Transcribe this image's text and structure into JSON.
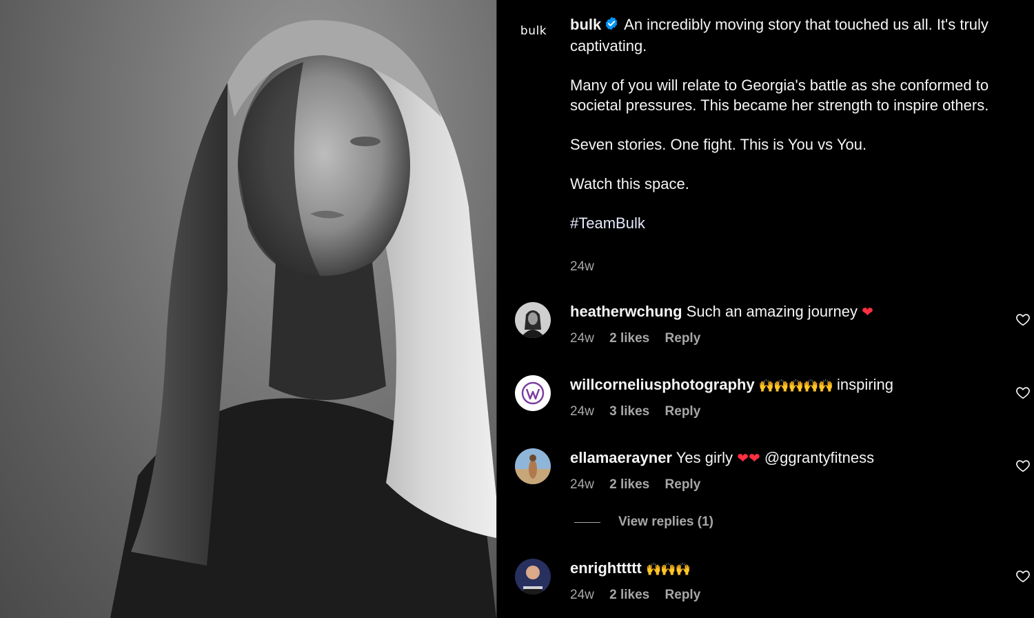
{
  "post": {
    "author": "bulk",
    "logo_text": "bulk",
    "caption_lines": [
      "An incredibly moving story that touched us all. It's truly captivating.",
      "Many of you will relate to Georgia's battle as she conformed to societal pressures. This became her strength to inspire others.",
      "Seven stories. One fight. This is You vs You.",
      "Watch this space.",
      "#TeamBulk"
    ],
    "time": "24w"
  },
  "comments": [
    {
      "user": "heatherwchung",
      "text": "Such an amazing journey",
      "emoji": "❤",
      "time": "24w",
      "likes": "2 likes",
      "reply": "Reply"
    },
    {
      "user": "willcorneliusphotography",
      "text": "inspiring",
      "emoji": "🙌🙌🙌🙌🙌",
      "time": "24w",
      "likes": "3 likes",
      "reply": "Reply"
    },
    {
      "user": "ellamaerayner",
      "text": "Yes girly",
      "emoji": "❤❤",
      "mention": "@ggrantyfitness",
      "time": "24w",
      "likes": "2 likes",
      "reply": "Reply"
    },
    {
      "user": "enrighttttt",
      "text": "",
      "emoji": "🙌🙌🙌",
      "time": "24w",
      "likes": "2 likes",
      "reply": "Reply"
    }
  ],
  "view_replies": "View replies (1)",
  "colors": {
    "background": "#000000",
    "text": "#f5f5f5",
    "muted": "#a8a8a8",
    "verified": "#0095f6",
    "heart": "#ff3040"
  },
  "icons": [
    "verified-badge-icon",
    "like-heart-icon"
  ]
}
